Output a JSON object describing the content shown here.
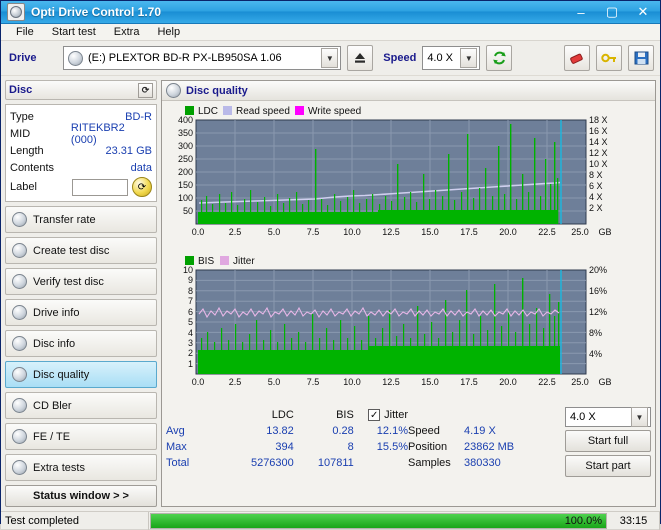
{
  "window": {
    "title": "Opti Drive Control 1.70",
    "icon": "disc-icon",
    "minimize": "–",
    "maximize": "▢",
    "close": "✕"
  },
  "menu": [
    {
      "label": "File"
    },
    {
      "label": "Start test"
    },
    {
      "label": "Extra"
    },
    {
      "label": "Help"
    }
  ],
  "drivebar": {
    "drive_label": "Drive",
    "drive_value": "(E:)  PLEXTOR BD-R   PX-LB950SA 1.06",
    "eject_icon": "eject-icon",
    "speed_label": "Speed",
    "speed_value": "4.0 X",
    "refresh_icon": "refresh-icon",
    "eraser_icon": "eraser-icon",
    "key_icon": "key-icon",
    "save_icon": "save-icon"
  },
  "disc_panel": {
    "title": "Disc",
    "refresh_icon": "refresh-icon",
    "rows": [
      {
        "key": "Type",
        "value": "BD-R"
      },
      {
        "key": "MID",
        "value": "RITEKBR2 (000)"
      },
      {
        "key": "Length",
        "value": "23.31 GB"
      },
      {
        "key": "Contents",
        "value": "data"
      }
    ],
    "label_key": "Label",
    "label_value": "",
    "label_button_icon": "refresh-yellow-icon"
  },
  "nav": [
    {
      "label": "Transfer rate",
      "icon": "disc-icon",
      "active": false
    },
    {
      "label": "Create test disc",
      "icon": "disc-icon",
      "active": false
    },
    {
      "label": "Verify test disc",
      "icon": "disc-icon",
      "active": false
    },
    {
      "label": "Drive info",
      "icon": "disc-icon",
      "active": false
    },
    {
      "label": "Disc info",
      "icon": "disc-icon",
      "active": false
    },
    {
      "label": "Disc quality",
      "icon": "disc-icon",
      "active": true
    },
    {
      "label": "CD Bler",
      "icon": "disc-icon",
      "active": false
    },
    {
      "label": "FE / TE",
      "icon": "disc-icon",
      "active": false
    },
    {
      "label": "Extra tests",
      "icon": "disc-icon",
      "active": false
    }
  ],
  "status_window_button": "Status window > >",
  "main": {
    "title": "Disc quality",
    "icon": "disc-icon"
  },
  "chart_data": [
    {
      "type": "line",
      "title": "Disc quality - LDC / Read speed / Write speed",
      "legend": [
        {
          "name": "LDC",
          "color": "#00a000"
        },
        {
          "name": "Read speed",
          "color": "#b9b9e8"
        },
        {
          "name": "Write speed",
          "color": "#ff00ff"
        }
      ],
      "legend_position": "top-left",
      "xlabel": "GB",
      "x_ticks": [
        "0.0",
        "2.5",
        "5.0",
        "7.5",
        "10.0",
        "12.5",
        "15.0",
        "17.5",
        "20.0",
        "22.5",
        "25.0"
      ],
      "xlim": [
        0,
        25.0
      ],
      "ylabel": "LDC",
      "y_ticks": [
        "400",
        "350",
        "300",
        "250",
        "200",
        "150",
        "100",
        "50"
      ],
      "ylim": [
        0,
        400
      ],
      "y2_ticks": [
        "18 X",
        "16 X",
        "14 X",
        "12 X",
        "10 X",
        "8 X",
        "6 X",
        "4 X",
        "2 X"
      ],
      "y2lim": [
        0,
        18
      ],
      "grid": true,
      "series": [
        {
          "name": "LDC",
          "color": "#00a000",
          "note": "dense green spikes across full span, baseline ~20-60, frequent spikes 150-400 after 12.5 GB"
        },
        {
          "name": "Read speed",
          "color": "#b9b9e8",
          "note": "rising line from ~3.8X to ~5.6X across the disc, ends near 22.9 GB"
        }
      ]
    },
    {
      "type": "line",
      "title": "Disc quality - BIS / Jitter",
      "legend": [
        {
          "name": "BIS",
          "color": "#00a000"
        },
        {
          "name": "Jitter",
          "color": "#e0a8e0"
        }
      ],
      "legend_position": "top-left",
      "xlabel": "GB",
      "x_ticks": [
        "0.0",
        "2.5",
        "5.0",
        "7.5",
        "10.0",
        "12.5",
        "15.0",
        "17.5",
        "20.0",
        "22.5",
        "25.0"
      ],
      "xlim": [
        0,
        25.0
      ],
      "ylabel": "BIS",
      "y_ticks": [
        "10",
        "9",
        "8",
        "7",
        "6",
        "5",
        "4",
        "3",
        "2",
        "1"
      ],
      "ylim": [
        0,
        10
      ],
      "y2_ticks": [
        "20%",
        "16%",
        "12%",
        "8%",
        "4%"
      ],
      "y2lim": [
        0,
        20
      ],
      "grid": true,
      "series": [
        {
          "name": "BIS",
          "color": "#00a000",
          "note": "dense green fill baseline ~2-3 rising to ~3.5, spikes to 10"
        },
        {
          "name": "Jitter",
          "color": "#e0a8e0",
          "note": "noisy band around 12-13%, i.e. plotted ~6-7 on left scale"
        }
      ]
    }
  ],
  "stats": {
    "headers": {
      "ldc": "LDC",
      "bis": "BIS"
    },
    "jitter_label": "Jitter",
    "jitter_checked": true,
    "rows": [
      {
        "label": "Avg",
        "ldc": "13.82",
        "bis": "0.28",
        "jitter": "12.1%"
      },
      {
        "label": "Max",
        "ldc": "394",
        "bis": "8",
        "jitter": "15.5%"
      },
      {
        "label": "Total",
        "ldc": "5276300",
        "bis": "107811",
        "jitter": ""
      }
    ],
    "right": {
      "speed_label": "Speed",
      "speed_value": "4.19 X",
      "position_label": "Position",
      "position_value": "23862 MB",
      "samples_label": "Samples",
      "samples_value": "380330",
      "speed_select": "4.0 X",
      "start_full": "Start full",
      "start_part": "Start part"
    }
  },
  "statusbar": {
    "message": "Test completed",
    "progress_pct": 100,
    "progress_text": "100.0%",
    "time": "33:15"
  }
}
